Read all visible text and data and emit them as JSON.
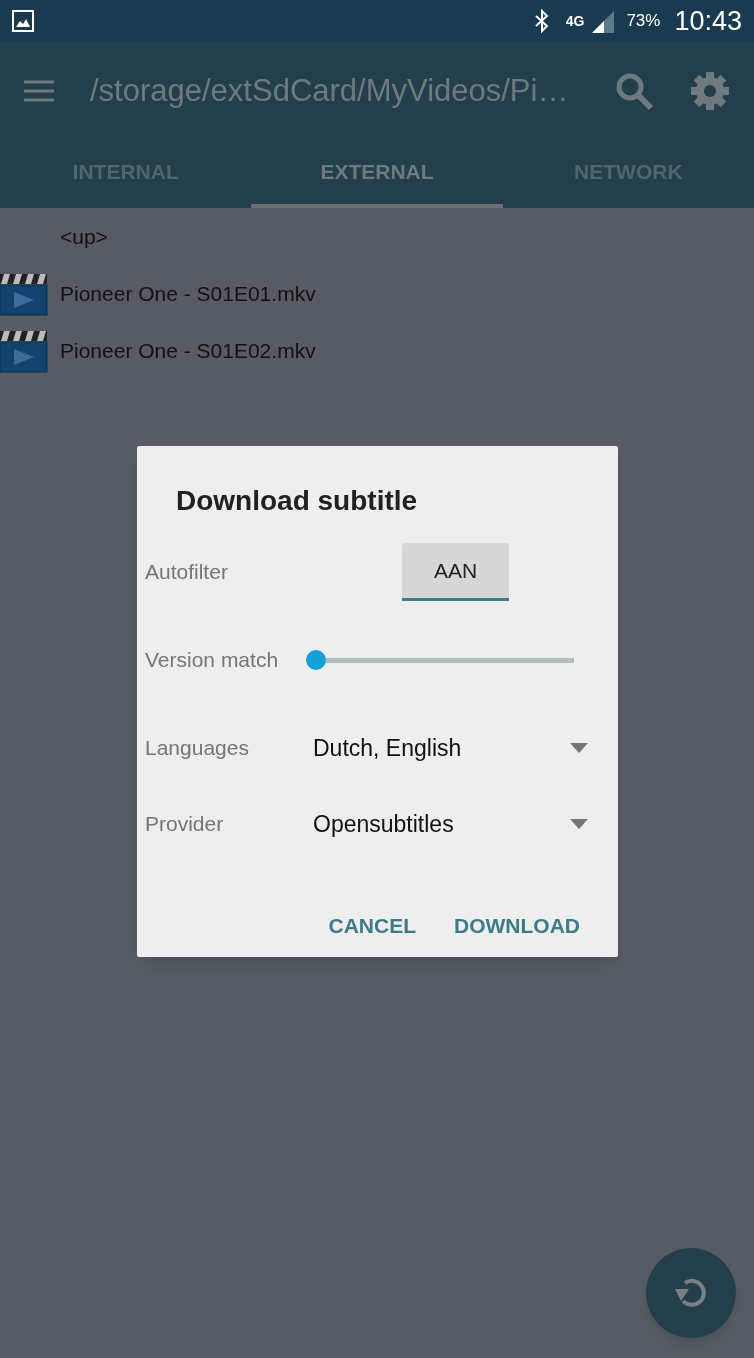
{
  "status_bar": {
    "network": "4G",
    "battery": "73%",
    "time": "10:43"
  },
  "toolbar": {
    "path": "/storage/extSdCard/MyVideos/Pi…"
  },
  "tabs": [
    {
      "label": "INTERNAL",
      "selected": false
    },
    {
      "label": "EXTERNAL",
      "selected": true
    },
    {
      "label": "NETWORK",
      "selected": false
    }
  ],
  "files": [
    {
      "name": "<up>",
      "kind": "parent"
    },
    {
      "name": "Pioneer One - S01E01.mkv",
      "kind": "video"
    },
    {
      "name": "Pioneer One - S01E02.mkv",
      "kind": "video"
    }
  ],
  "dialog": {
    "title": "Download subtitle",
    "rows": [
      {
        "kind": "toggle",
        "label": "Autofilter",
        "value": "AAN",
        "on": true
      },
      {
        "kind": "slider",
        "label": "Version match",
        "level": 0
      },
      {
        "kind": "dropdown",
        "label": "Languages",
        "value": "Dutch, English"
      },
      {
        "kind": "dropdown",
        "label": "Provider",
        "value": "Opensubtitles"
      }
    ],
    "buttons": [
      "CANCEL",
      "DOWNLOAD"
    ]
  }
}
